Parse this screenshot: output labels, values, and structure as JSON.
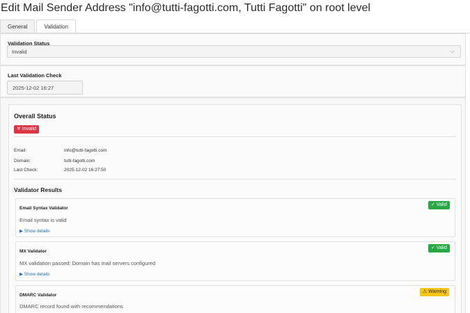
{
  "page": {
    "title": "Edit Mail Sender Address \"info@tutti-fagotti.com, Tutti Fagotti\" on root level"
  },
  "tabs": [
    {
      "label": "General",
      "active": false
    },
    {
      "label": "Validation",
      "active": true
    }
  ],
  "validation_status": {
    "label": "Validation Status",
    "value": "Invalid",
    "icon": "chevron-down-icon"
  },
  "last_check": {
    "label": "Last Validation Check",
    "value": "2025-12-02 16:27"
  },
  "overall": {
    "heading": "Overall Status",
    "badge": "✕ Invalid",
    "badge_color": "#dc3545",
    "email_label": "Email:",
    "email_value": "info@tutti-fagotti.com",
    "domain_label": "Domain:",
    "domain_value": "tutti-fagotti.com",
    "lastcheck_label": "Last Check:",
    "lastcheck_value": "2025-12-02 16:27:50"
  },
  "results": {
    "heading": "Validator Results",
    "validators": [
      {
        "name": "Email Syntax Validator",
        "message": "Email syntax is valid",
        "badge": "✓ Valid",
        "badge_color": "#28a745",
        "details": "▶ Show details"
      },
      {
        "name": "MX Validator",
        "message": "MX validation passed: Domain has mail servers configured",
        "badge": "✓ Valid",
        "badge_color": "#28a745",
        "details": "▶ Show details"
      },
      {
        "name": "DMARC Validator",
        "message": "DMARC record found with recommendations",
        "badge": "⚠ Warning",
        "badge_color": "#f5c518"
      }
    ]
  }
}
